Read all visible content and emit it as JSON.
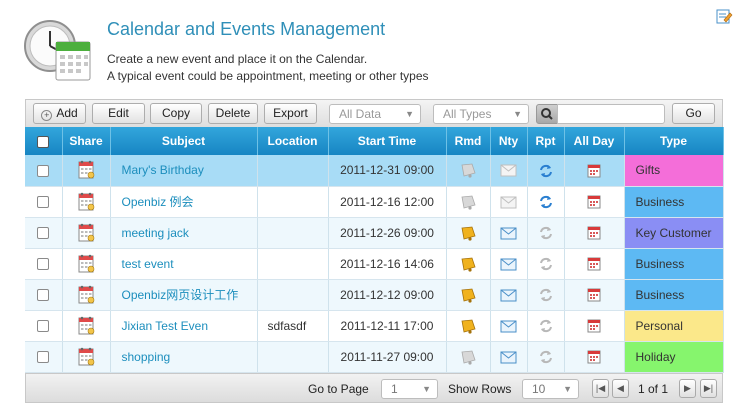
{
  "header": {
    "title": "Calendar and Events Management",
    "desc_line1": "Create a new event and place it on the Calendar.",
    "desc_line2": "A typical event could be appointment, meeting or other types"
  },
  "toolbar": {
    "add_label": "Add",
    "edit_label": "Edit",
    "copy_label": "Copy",
    "delete_label": "Delete",
    "export_label": "Export",
    "filter_data": "All Data",
    "filter_types": "All Types",
    "search_value": "",
    "go_label": "Go"
  },
  "grid": {
    "columns": [
      "Share",
      "Subject",
      "Location",
      "Start Time",
      "Rmd",
      "Nty",
      "Rpt",
      "All Day",
      "Type"
    ],
    "rows": [
      {
        "subject": "Mary's Birthday",
        "location": "",
        "start": "2011-12-31 09:00",
        "rmd": "off",
        "nty": "off",
        "rpt": "on",
        "type": "Gifts",
        "type_color": "#f46ed9"
      },
      {
        "subject": "Openbiz 例会",
        "location": "",
        "start": "2011-12-16 12:00",
        "rmd": "off",
        "nty": "off",
        "rpt": "on",
        "type": "Business",
        "type_color": "#5db9f3"
      },
      {
        "subject": "meeting jack",
        "location": "",
        "start": "2011-12-26 09:00",
        "rmd": "on",
        "nty": "on",
        "rpt": "off",
        "type": "Key Customer",
        "type_color": "#8a8ef4"
      },
      {
        "subject": "test event",
        "location": "",
        "start": "2011-12-16 14:06",
        "rmd": "on",
        "nty": "on",
        "rpt": "off",
        "type": "Business",
        "type_color": "#5db9f3"
      },
      {
        "subject": "Openbiz网页设计工作",
        "location": "",
        "start": "2011-12-12 09:00",
        "rmd": "on",
        "nty": "on",
        "rpt": "off",
        "type": "Business",
        "type_color": "#5db9f3"
      },
      {
        "subject": "Jixian Test Even",
        "location": "sdfasdf",
        "start": "2011-12-11 17:00",
        "rmd": "on",
        "nty": "on",
        "rpt": "off",
        "type": "Personal",
        "type_color": "#fbe88a"
      },
      {
        "subject": "shopping",
        "location": "",
        "start": "2011-11-27 09:00",
        "rmd": "off",
        "nty": "on",
        "rpt": "off",
        "type": "Holiday",
        "type_color": "#86f56d"
      }
    ],
    "selected_row": 0
  },
  "footer": {
    "goto_label": "Go to Page",
    "page_value": "1",
    "show_rows_label": "Show Rows",
    "rows_value": "10",
    "page_info": "1 of 1"
  }
}
